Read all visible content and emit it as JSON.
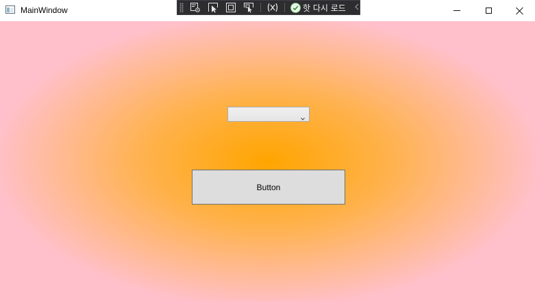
{
  "window": {
    "title": "MainWindow"
  },
  "icons": {
    "app": "app-window-icon",
    "minimize": "minimize-icon",
    "maximize": "maximize-icon",
    "close": "close-icon",
    "select_element": "select-element-icon",
    "display_layout_adorners": "display-layout-adorners-icon",
    "track_focus": "track-focus-icon",
    "binding_failures": "binding-failures-icon",
    "hot_reload_status": "check-circle-icon",
    "collapse": "chevron-left-icon"
  },
  "debug_toolbar": {
    "hot_reload_label": "핫 다시 로드"
  },
  "content": {
    "combo_value": "",
    "button_label": "Button"
  },
  "colors": {
    "gradient_center": "#ffa500",
    "gradient_edge": "#ffc0cb",
    "button_background": "#dddddd",
    "toolbar_background": "#2d2d30"
  }
}
